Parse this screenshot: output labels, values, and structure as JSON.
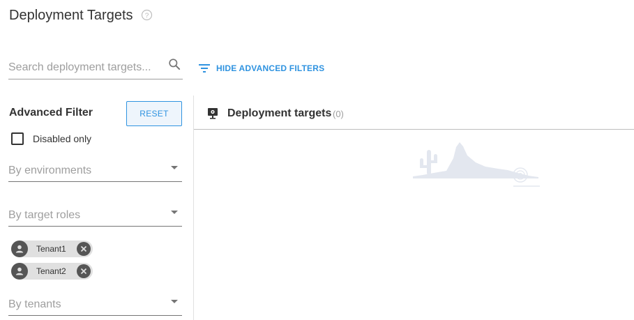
{
  "page": {
    "title": "Deployment Targets"
  },
  "search": {
    "placeholder": "Search deployment targets..."
  },
  "advanced_toggle": {
    "label": "HIDE ADVANCED FILTERS"
  },
  "sidebar": {
    "title": "Advanced Filter",
    "reset_label": "RESET",
    "disabled_only_label": "Disabled only",
    "disabled_only_checked": false,
    "environments_label": "By environments",
    "roles_label": "By target roles",
    "tenants": [
      "Tenant1",
      "Tenant2"
    ],
    "tenants_label": "By tenants"
  },
  "main": {
    "title": "Deployment targets",
    "count": "(0)"
  },
  "colors": {
    "accent": "#2f93e0",
    "chip_bg": "#e0e0e0",
    "chip_dark": "#555555"
  },
  "icons": [
    "help-icon",
    "search-icon",
    "filter-icon",
    "person-icon",
    "close-icon",
    "deployment-target-icon",
    "caret-down-icon"
  ]
}
